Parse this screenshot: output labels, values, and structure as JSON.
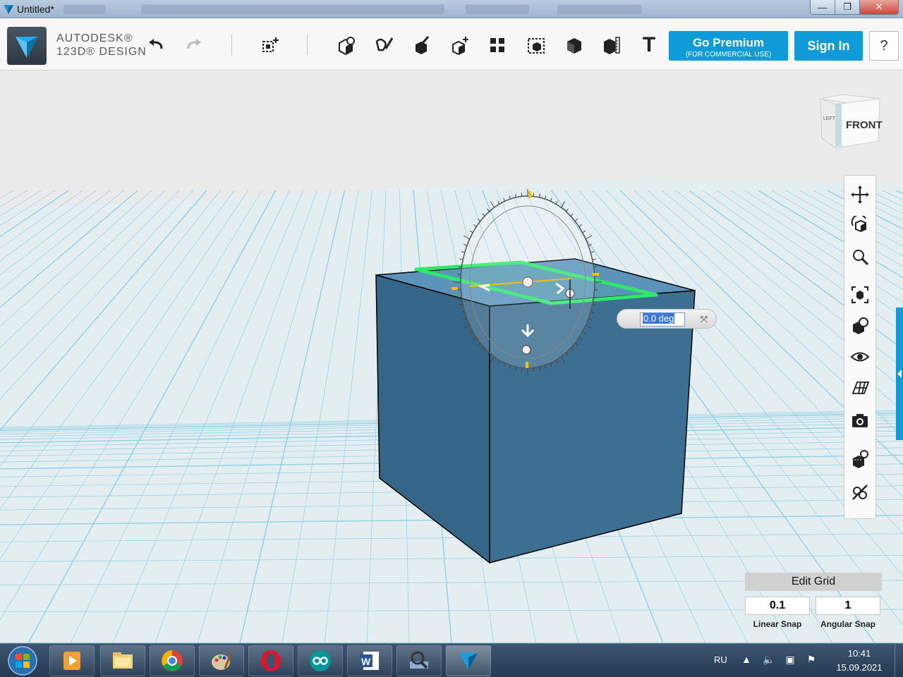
{
  "window": {
    "title": "Untitled*"
  },
  "window_controls": {
    "minimize": "—",
    "maximize": "❐",
    "close": "✕"
  },
  "brand": {
    "line1": "AUTODESK®",
    "line2": "123D® DESIGN"
  },
  "toolbar": {
    "go_premium": "Go Premium",
    "go_premium_sub": "(FOR COMMERCIAL USE)",
    "sign_in": "Sign In",
    "help": "?",
    "text_tool": "T",
    "tools": [
      "undo-icon",
      "redo-icon",
      "transform-icon",
      "primitives-icon",
      "sketch-icon",
      "construct-icon",
      "modify-icon",
      "pattern-icon",
      "group-icon",
      "combine-icon",
      "measure-icon",
      "text-icon"
    ]
  },
  "viewport": {
    "angle_value": "0.0 deg",
    "viewcube": {
      "face_front": "FRONT",
      "face_left": "LEFT"
    },
    "colors": {
      "grid": "#8fd0e6",
      "floor": "#e4eef1",
      "sky": "#e6e6e6",
      "box_front": "#3c6f92",
      "box_top": "#4d88b3",
      "selection": "#2ee86b",
      "accent": "#0f9bd7"
    }
  },
  "navbar": {
    "buttons": [
      "pan-icon",
      "orbit-icon",
      "zoom-icon",
      "fit-icon",
      "view-mode-icon",
      "visibility-icon",
      "grid-icon",
      "camera-icon",
      "material-icon",
      "physical-icon"
    ]
  },
  "edit_grid": {
    "title": "Edit Grid",
    "linear_snap_value": "0.1",
    "linear_snap_label": "Linear Snap",
    "angular_snap_value": "1",
    "angular_snap_label": "Angular Snap"
  },
  "taskbar": {
    "apps": [
      "media-player-icon",
      "file-explorer-icon",
      "chrome-icon",
      "paint-icon",
      "opera-icon",
      "arduino-icon",
      "word-icon",
      "search-tool-icon",
      "123d-design-icon"
    ],
    "active_app": "123d-design-icon",
    "language": "RU",
    "time": "10:41",
    "date": "15.09.2021"
  }
}
